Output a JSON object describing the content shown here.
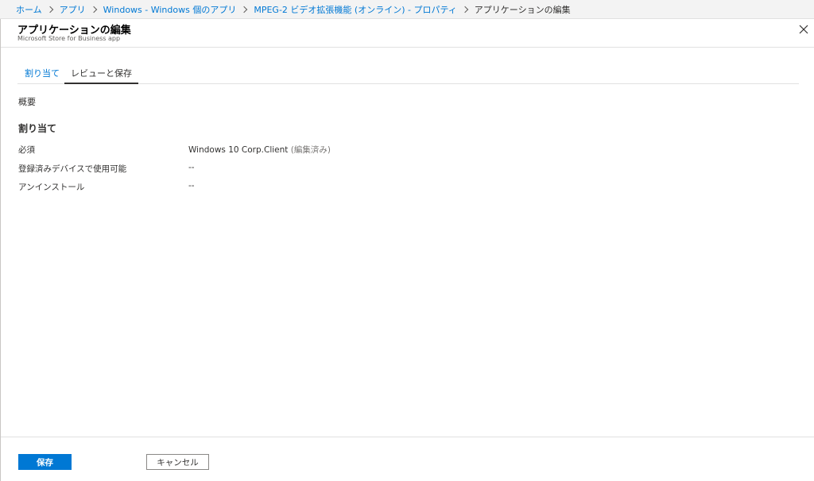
{
  "breadcrumb": {
    "items": [
      {
        "label": "ホーム"
      },
      {
        "label": "アプリ"
      },
      {
        "label": "Windows - Windows 個のアプリ"
      },
      {
        "label": "MPEG-2 ビデオ拡張機能 (オンライン) - プロパティ"
      }
    ],
    "current": "アプリケーションの編集"
  },
  "blade": {
    "title": "アプリケーションの編集",
    "subtitle": "Microsoft Store for Business app",
    "close_icon": "close-icon"
  },
  "tabs": [
    {
      "label": "割り当て",
      "active": false
    },
    {
      "label": "レビューと保存",
      "active": true
    }
  ],
  "summary_label": "概要",
  "assignments": {
    "title": "割り当て",
    "rows": [
      {
        "label": "必須",
        "value": "Windows 10 Corp.Client",
        "tag": "(編集済み)"
      },
      {
        "label": "登録済みデバイスで使用可能",
        "value": "--"
      },
      {
        "label": "アンインストール",
        "value": "--"
      }
    ]
  },
  "footer": {
    "save_label": "保存",
    "cancel_label": "キャンセル"
  },
  "colors": {
    "accent": "#0078d4",
    "text": "#323130",
    "muted": "#797775",
    "breadcrumb_bg": "#f3f3f3"
  }
}
